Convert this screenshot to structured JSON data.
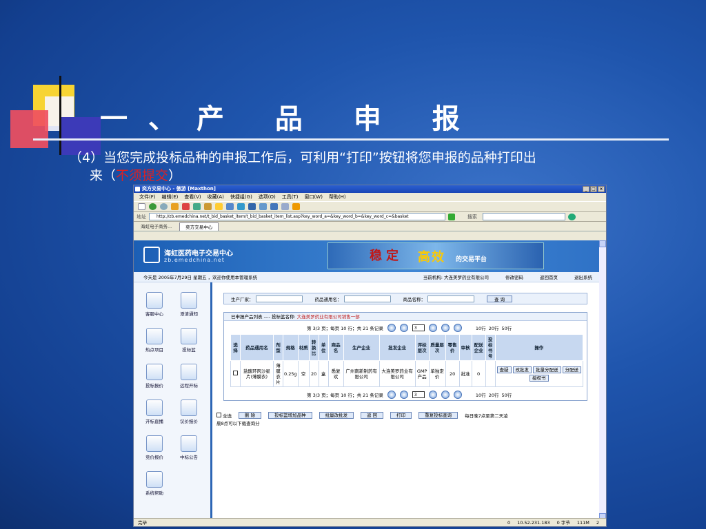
{
  "slide": {
    "title": "一、产 品 申 报",
    "text_line1": "（4）当您完成投标品种的申报工作后，可利用“打印”按钮将您申报的品种打印出",
    "text_line2_prefix": "来（",
    "text_line2_red": "不须提交",
    "text_line2_suffix": "）"
  },
  "browser": {
    "title": "奕方交易中心 - 傲游 [Maxthon]",
    "window_buttons": [
      "_",
      "□",
      "×"
    ],
    "menu": [
      "文件(F)",
      "编辑(E)",
      "查看(V)",
      "收藏(A)",
      "快捷组(G)",
      "选项(O)",
      "工具(T)",
      "窗口(W)",
      "帮助(H)"
    ],
    "address_label": "地址",
    "address_url": "http://zb.emedchina.net/t_bid_basket_item/t_bid_basket_item_list.asp?key_word_a=&key_word_b=&key_word_c=&basket",
    "search_label": "搜索",
    "tabs": [
      "海虹电子商务...",
      "奕方交易中心"
    ],
    "status_left": "完毕",
    "status_ip": "10.52.231.183",
    "status_bytes": "0 字节",
    "status_mem": "111M",
    "status_count": "2",
    "status_zero": "0"
  },
  "site": {
    "name": "海虹医药电子交易中心",
    "domain": "zb.emedchina.net",
    "banner_a": "稳定",
    "banner_b": "高效",
    "banner_c": "的交易平台",
    "date_text": "今天是 2005年7月29日 星期五 ，欢迎你使用本管理系统",
    "org_text": "当前机构: 大连美罗药业有限公司",
    "links": [
      "修改密码",
      "返回首页",
      "退出系统"
    ]
  },
  "sidebar": [
    "客服中心",
    "澄清通知",
    "热点项目",
    "投标篮",
    "投标报价",
    "远程开标",
    "开标直播",
    "议价报价",
    "竞价报价",
    "中标公告",
    "系统帮助"
  ],
  "query": {
    "manufacturer_label": "生产厂家：",
    "generic_label": "药品通用名：",
    "product_label": "商品名称：",
    "search_button": "查 询"
  },
  "list": {
    "header_prefix": "已申报产品列表 ---- 投标篮名称:",
    "basket_name": "大连美罗药业有限公司销售一部",
    "pager_text": "第 3/3 页；每页 10 行；共 21 条记录",
    "page_value": "3",
    "page_sizes": [
      "10行",
      "20行",
      "50行"
    ],
    "columns": [
      "选择",
      "药品通用名",
      "剂型",
      "规格",
      "材质",
      "转换比",
      "单位",
      "商品名",
      "生产企业",
      "批发企业",
      "评标层次",
      "质量层次",
      "零售价",
      "审核",
      "配送企业",
      "投标书号",
      "操作"
    ],
    "row": [
      "",
      "盐酸环丙沙星片(薄膜衣)",
      "薄膜衣片",
      "0.25g",
      "空",
      "20",
      "盒",
      "悉复欢",
      "广州南新制药有限公司",
      "大连美罗药业有限公司",
      "GMP产品",
      "单独定价",
      "20",
      "批准",
      "0",
      ""
    ],
    "ops": [
      "查疑",
      "改批发",
      "批量分配送",
      "分配送",
      "授权书"
    ]
  },
  "actions": {
    "select_all": "全选",
    "buttons": [
      "删 除",
      "投标篮增加品种",
      "批量改批发",
      "返 回",
      "打印",
      "重复投标查询"
    ],
    "note1": "每日晚7点至第二天凌",
    "note2": "晨8点可以下载查询分"
  }
}
